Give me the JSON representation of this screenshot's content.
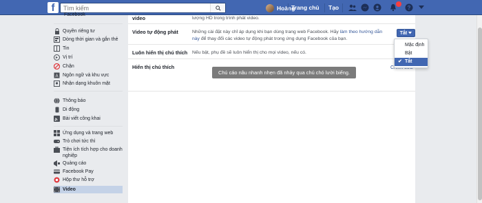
{
  "topbar": {
    "logo": "f",
    "search_placeholder": "Tìm kiếm",
    "user_name": "Hoàng",
    "home_label": "Trang chủ",
    "create_label": "Tạo"
  },
  "sidebar": {
    "cut_top": "Facebook",
    "group1": [
      {
        "label": "Quyền riêng tư",
        "icon": "lock-icon"
      },
      {
        "label": "Dòng thời gian và gắn thẻ",
        "icon": "timeline-icon"
      },
      {
        "label": "Tin",
        "icon": "book-icon"
      },
      {
        "label": "Vị trí",
        "icon": "location-icon"
      },
      {
        "label": "Chặn",
        "icon": "block-icon"
      },
      {
        "label": "Ngôn ngữ và khu vực",
        "icon": "language-icon"
      },
      {
        "label": "Nhận dạng khuôn mặt",
        "icon": "face-icon"
      }
    ],
    "group2": [
      {
        "label": "Thông báo",
        "icon": "globe-icon"
      },
      {
        "label": "Di động",
        "icon": "mobile-icon"
      },
      {
        "label": "Bài viết công khai",
        "icon": "rss-icon"
      }
    ],
    "group3": [
      {
        "label": "Ứng dụng và trang web",
        "icon": "apps-icon"
      },
      {
        "label": "Trò chơi tức thì",
        "icon": "game-icon"
      },
      {
        "label": "Tiện ích tích hợp cho doanh nghiệp",
        "icon": "business-icon"
      },
      {
        "label": "Quảng cáo",
        "icon": "ads-icon"
      },
      {
        "label": "Facebook Pay",
        "icon": "pay-icon"
      },
      {
        "label": "Hộp thư hỗ trợ",
        "icon": "support-icon"
      },
      {
        "label": "Video",
        "icon": "video-icon"
      }
    ]
  },
  "settings": {
    "row0": {
      "label": "video",
      "desc": "lượng HD trong trình phát video."
    },
    "row1": {
      "label": "Video tự động phát",
      "desc_pre": "Những cài đặt này chỉ áp dụng khi bạn dùng trang web Facebook. Hãy ",
      "desc_link": "làm theo hướng dẫn này",
      "desc_post": " để thay đổi các video tự động phát trong ứng dụng Facebook của bạn."
    },
    "row2": {
      "label": "Luôn hiển thị chú thích",
      "desc": "Nếu bật, phụ đề sẽ luôn hiển thị cho mọi video, nếu có."
    },
    "row3": {
      "label": "Hiển thị chú thích"
    }
  },
  "autoplay_button": {
    "label": "Tắt"
  },
  "dropdown": {
    "options": [
      "Mặc định",
      "Bật",
      "Tắt"
    ],
    "selected": "Tắt"
  },
  "edit_link": "Chỉnh sửa",
  "tooltip_text": "Chú cáo nâu nhanh nhẹn đã nhảy qua chú chó lười biếng.",
  "colors": {
    "brand": "#4267b2",
    "badge": "#fa3e3e"
  }
}
